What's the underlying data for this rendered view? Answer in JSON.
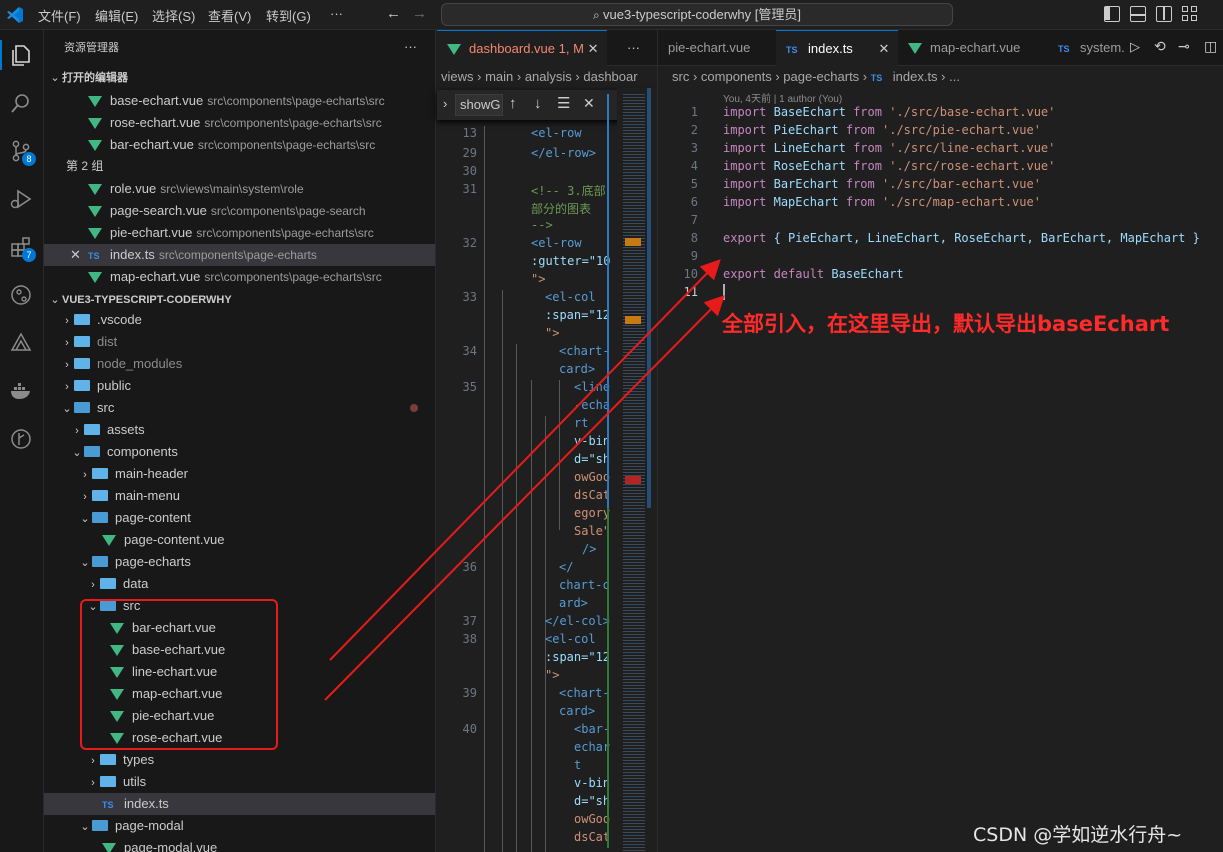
{
  "titlebar": {
    "menus": [
      "文件(F)",
      "编辑(E)",
      "选择(S)",
      "查看(V)",
      "转到(G)",
      "···"
    ],
    "search_text": "vue3-typescript-coderwhy [管理员]"
  },
  "activity": {
    "badges": {
      "scm": "8",
      "extensions": "7"
    }
  },
  "sidebar": {
    "explorer_title": "资源管理器",
    "more": "···",
    "open_editors_title": "打开的编辑器",
    "open_editors": [
      {
        "name": "base-echart.vue",
        "path": "src\\components\\page-echarts\\src",
        "type": "vue"
      },
      {
        "name": "rose-echart.vue",
        "path": "src\\components\\page-echarts\\src",
        "type": "vue"
      },
      {
        "name": "bar-echart.vue",
        "path": "src\\components\\page-echarts\\src",
        "type": "vue"
      }
    ],
    "group2_title": "第 2 组",
    "group2": [
      {
        "name": "role.vue",
        "path": "src\\views\\main\\system\\role",
        "type": "vue"
      },
      {
        "name": "page-search.vue",
        "path": "src\\components\\page-search",
        "type": "vue"
      },
      {
        "name": "pie-echart.vue",
        "path": "src\\components\\page-echarts\\src",
        "type": "vue"
      },
      {
        "name": "index.ts",
        "path": "src\\components\\page-echarts",
        "type": "ts"
      },
      {
        "name": "map-echart.vue",
        "path": "src\\components\\page-echarts\\src",
        "type": "vue"
      }
    ],
    "project_title": "VUE3-TYPESCRIPT-CODERWHY",
    "tree": [
      {
        "name": ".vscode"
      },
      {
        "name": "dist"
      },
      {
        "name": "node_modules"
      },
      {
        "name": "public"
      },
      {
        "name": "src"
      },
      {
        "name": "assets"
      },
      {
        "name": "components"
      },
      {
        "name": "main-header"
      },
      {
        "name": "main-menu"
      },
      {
        "name": "page-content"
      },
      {
        "name": "page-content.vue"
      },
      {
        "name": "page-echarts"
      },
      {
        "name": "data"
      },
      {
        "name": "src"
      },
      {
        "name": "bar-echart.vue"
      },
      {
        "name": "base-echart.vue"
      },
      {
        "name": "line-echart.vue"
      },
      {
        "name": "map-echart.vue"
      },
      {
        "name": "pie-echart.vue"
      },
      {
        "name": "rose-echart.vue"
      },
      {
        "name": "types"
      },
      {
        "name": "utils"
      },
      {
        "name": "index.ts"
      },
      {
        "name": "page-modal"
      },
      {
        "name": "page-modal.vue"
      }
    ]
  },
  "editor1": {
    "tab": "dashboard.vue",
    "tab_status": "1, M",
    "more": "···",
    "breadcrumb": [
      "views",
      "main",
      "analysis",
      "dashboar"
    ],
    "find_text": "showG",
    "line_numbers": [
      "13",
      "29",
      "30",
      "31",
      "32",
      "33",
      "34",
      "35",
      "36",
      "37",
      "38",
      "39",
      "40"
    ],
    "code": [
      "<el-row",
      "</el-row>",
      "<!-- 3.底部",
      "部分的图表",
      "-->",
      "<el-row",
      ":gutter=\"10",
      "\">",
      "<el-col",
      ":span=\"12",
      "\">",
      "<chart-",
      "card>",
      "<line",
      "-echa",
      "rt",
      "v-bin",
      "d=\"sh",
      "owGoo",
      "dsCat",
      "egory",
      "Sale\"",
      "/>",
      "</",
      "chart-c",
      "ard>",
      "</el-col>",
      "<el-col",
      ":span=\"12",
      "\">",
      "<chart-",
      "card>",
      "<bar-",
      "echar",
      "t",
      "v-bin",
      "d=\"sh",
      "owGoo",
      "dsCat"
    ]
  },
  "editor2": {
    "tabs": [
      "pie-echart.vue",
      "index.ts",
      "map-echart.vue",
      "system."
    ],
    "breadcrumb": [
      "src",
      "components",
      "page-echarts",
      "index.ts",
      "..."
    ],
    "codelens": "You, 4天前 | 1 author (You)",
    "lines": [
      {
        "n": "1",
        "kw": "import",
        "name": "BaseEchart",
        "from": "from",
        "str": "'./src/base-echart.vue'"
      },
      {
        "n": "2",
        "kw": "import",
        "name": "PieEchart",
        "from": "from",
        "str": "'./src/pie-echart.vue'"
      },
      {
        "n": "3",
        "kw": "import",
        "name": "LineEchart",
        "from": "from",
        "str": "'./src/line-echart.vue'"
      },
      {
        "n": "4",
        "kw": "import",
        "name": "RoseEchart",
        "from": "from",
        "str": "'./src/rose-echart.vue'"
      },
      {
        "n": "5",
        "kw": "import",
        "name": "BarEchart",
        "from": "from",
        "str": "'./src/bar-echart.vue'"
      },
      {
        "n": "6",
        "kw": "import",
        "name": "MapEchart",
        "from": "from",
        "str": "'./src/map-echart.vue'"
      }
    ],
    "line7": "7",
    "line8": {
      "n": "8",
      "kw": "export",
      "body": "{ PieEchart, LineEchart, RoseEchart, BarEchart, MapEchart }"
    },
    "line9": "9",
    "line10": {
      "n": "10",
      "kw": "export default",
      "name": "BaseEchart"
    },
    "line11": "11",
    "annotation": "全部引入，在这里导出，默认导出baseEchart",
    "watermark": "CSDN @学如逆水行舟~"
  },
  "colors": {
    "accent": "#0078d4",
    "vue": "#41b883",
    "ts": "#3b8eea",
    "annotation": "#ff2a2a"
  }
}
